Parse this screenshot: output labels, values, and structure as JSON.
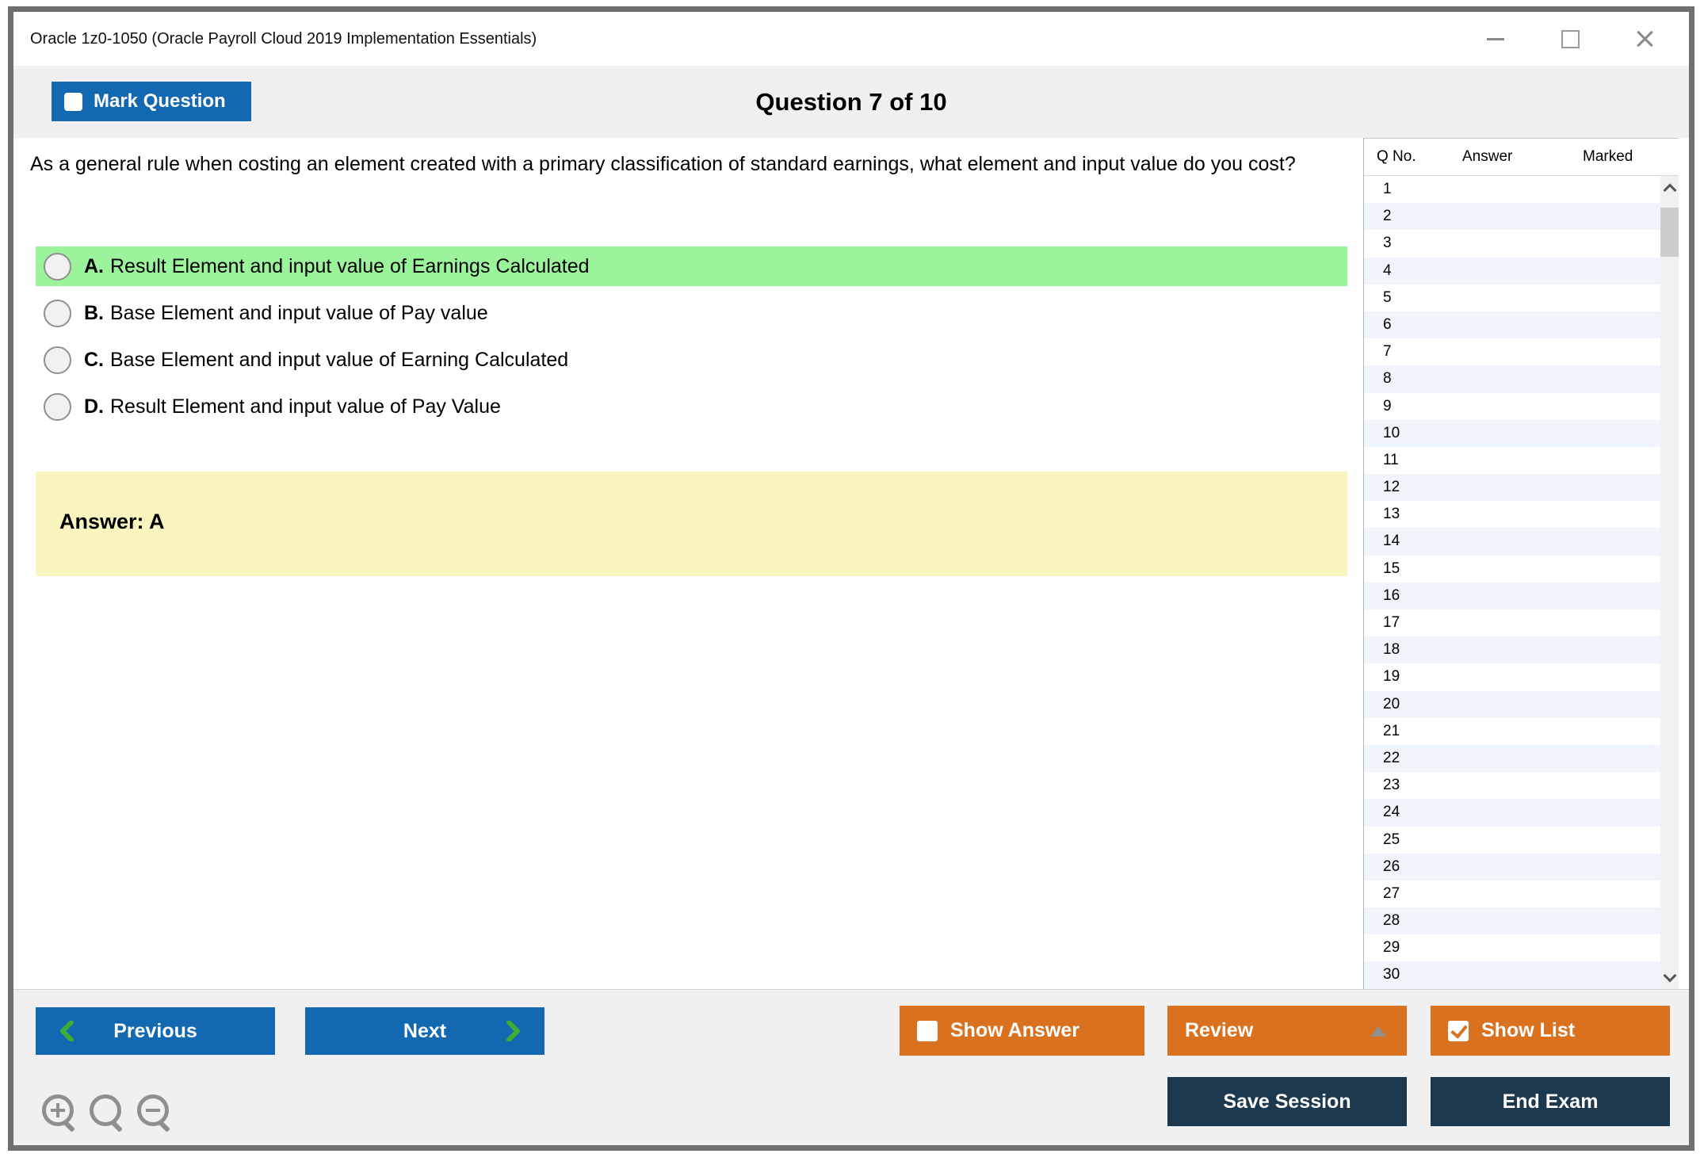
{
  "window": {
    "title": "Oracle 1z0-1050 (Oracle Payroll Cloud 2019 Implementation Essentials)"
  },
  "header": {
    "mark_question_label": "Mark Question",
    "question_counter": "Question 7 of 10"
  },
  "question": {
    "text": "As a general rule when costing an element created with a primary classification of standard earnings, what element and input value do you cost?",
    "options": [
      {
        "letter": "A.",
        "text": "Result Element and input value of Earnings Calculated",
        "highlighted": true
      },
      {
        "letter": "B.",
        "text": "Base Element and input value of Pay value",
        "highlighted": false
      },
      {
        "letter": "C.",
        "text": "Base Element and input value of Earning Calculated",
        "highlighted": false
      },
      {
        "letter": "D.",
        "text": "Result Element and input value of Pay Value",
        "highlighted": false
      }
    ],
    "answer_label": "Answer: A"
  },
  "question_list": {
    "columns": [
      "Q No.",
      "Answer",
      "Marked"
    ],
    "rows": [
      "1",
      "2",
      "3",
      "4",
      "5",
      "6",
      "7",
      "8",
      "9",
      "10",
      "11",
      "12",
      "13",
      "14",
      "15",
      "16",
      "17",
      "18",
      "19",
      "20",
      "21",
      "22",
      "23",
      "24",
      "25",
      "26",
      "27",
      "28",
      "29",
      "30"
    ]
  },
  "footer": {
    "previous_label": "Previous",
    "next_label": "Next",
    "show_answer_label": "Show Answer",
    "review_label": "Review",
    "show_list_label": "Show List",
    "save_session_label": "Save Session",
    "end_exam_label": "End Exam"
  },
  "colors": {
    "accent_blue": "#1269B1",
    "accent_orange": "#D9711E",
    "accent_navy": "#1D394F",
    "highlight_green": "#9BF49B",
    "highlight_yellow": "#FAF4BE",
    "chrome_gray": "#F0F0F0",
    "row_alt_blue": "#EFF5FA",
    "chevron_green": "#3AAE35"
  }
}
